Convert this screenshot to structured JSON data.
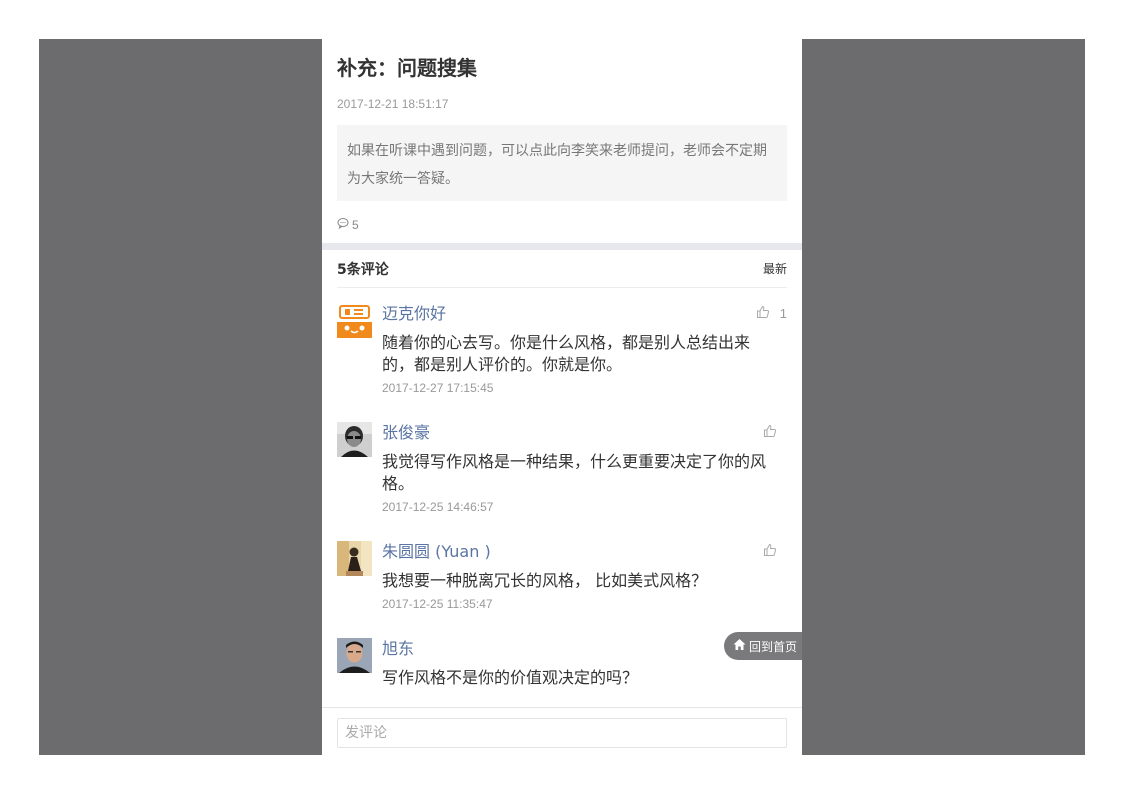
{
  "article": {
    "title": "补充：问题搜集",
    "date": "2017-12-21 18:51:17",
    "summary": "如果在听课中遇到问题，可以点此向李笑来老师提问，老师会不定期为大家统一答疑。",
    "comment_count": "5"
  },
  "comments_section": {
    "count_label": "5条评论",
    "sort_label": "最新",
    "items": [
      {
        "name": "迈克你好",
        "text": "随着你的心去写。你是什么风格，都是别人总结出来的，都是别人评价的。你就是你。",
        "date": "2017-12-27 17:15:45",
        "likes": "1"
      },
      {
        "name": "张俊豪",
        "text": "我觉得写作风格是一种结果，什么更重要决定了你的风格。",
        "date": "2017-12-25 14:46:57",
        "likes": ""
      },
      {
        "name": "朱圆圆 (Yuan )",
        "text": "我想要一种脱离冗长的风格， 比如美式风格？",
        "date": "2017-12-25 11:35:47",
        "likes": ""
      },
      {
        "name": "旭东",
        "text": "写作风格不是你的价值观决定的吗？",
        "date": "",
        "likes": ""
      }
    ]
  },
  "home_button": {
    "label": "回到首页"
  },
  "comment_input": {
    "placeholder": "发评论"
  },
  "colors": {
    "frame_bg": "#6c6c6e",
    "name_link": "#5a74a3",
    "separator": "#e7e7ee",
    "avatar1_brand": "#f08a1c"
  }
}
